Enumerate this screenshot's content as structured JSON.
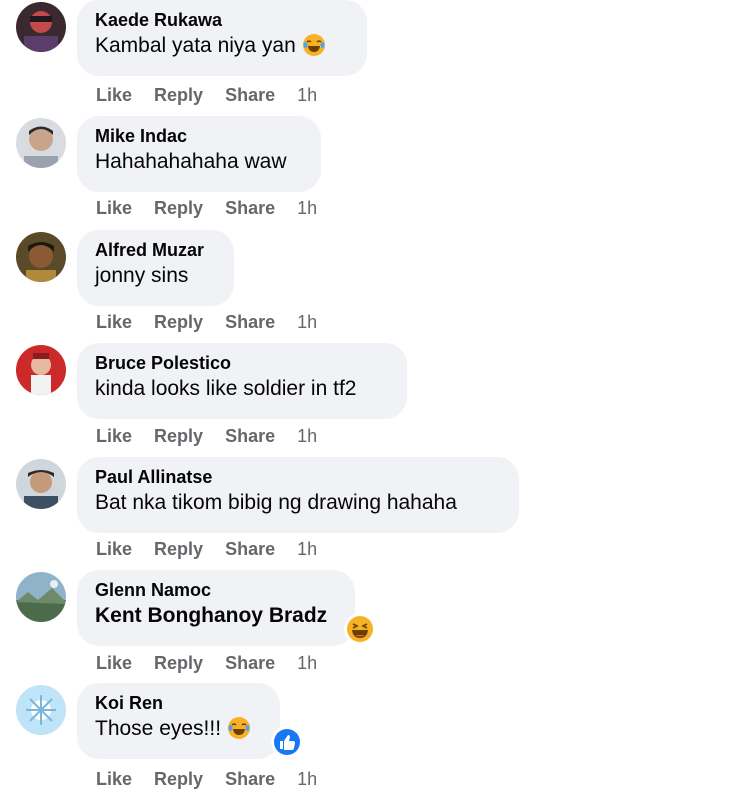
{
  "actions": {
    "like": "Like",
    "reply": "Reply",
    "share": "Share"
  },
  "comments": [
    {
      "author": "Kaede Rukawa",
      "text": "Kambal yata niya yan",
      "time": "1h",
      "emoji": "crying-laughing-emoji"
    },
    {
      "author": "Mike Indac",
      "text": "Hahahahahaha waw",
      "time": "1h"
    },
    {
      "author": "Alfred Muzar",
      "text": "jonny sins",
      "time": "1h"
    },
    {
      "author": "Bruce Polestico",
      "text": "kinda looks like soldier in tf2",
      "time": "1h"
    },
    {
      "author": "Paul Allinatse",
      "text": "Bat nka tikom bibig ng drawing hahaha",
      "time": "1h"
    },
    {
      "author": "Glenn Namoc",
      "text": "Kent Bonghanoy Bradz",
      "time": "1h",
      "reaction": "laughing-reaction-icon"
    },
    {
      "author": "Koi Ren",
      "text": "Those eyes!!!",
      "time": "1h",
      "emoji": "crying-laughing-emoji",
      "reaction": "like-reaction-icon"
    }
  ],
  "colors": {
    "bubble": "#f0f2f5",
    "name": "#050505",
    "meta": "#65676b",
    "like_blue": "#1877f2",
    "haha_yellow": "#f7b125"
  }
}
